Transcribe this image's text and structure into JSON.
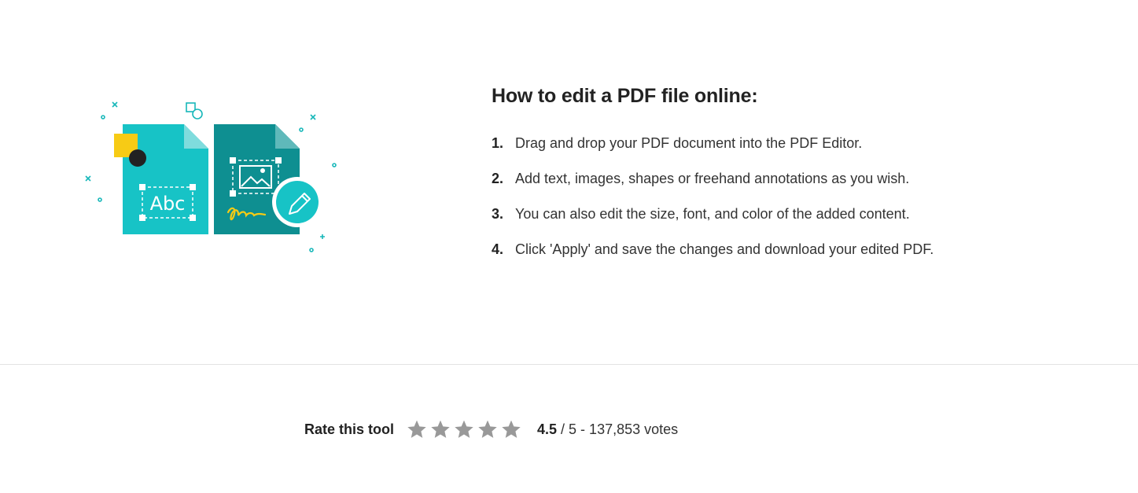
{
  "illustration": {
    "abc_text": "Abc"
  },
  "howto": {
    "title": "How to edit a PDF file online:",
    "steps": [
      {
        "num": "1.",
        "text": "Drag and drop your PDF document into the PDF Editor."
      },
      {
        "num": "2.",
        "text": "Add text, images, shapes or freehand annotations as you wish."
      },
      {
        "num": "3.",
        "text": "You can also edit the size, font, and color of the added content."
      },
      {
        "num": "4.",
        "text": "Click 'Apply' and save the changes and download your edited PDF."
      }
    ]
  },
  "rating": {
    "label": "Rate this tool",
    "score": "4.5",
    "rest": "/ 5 - 137,853 votes",
    "star_count": 5,
    "star_color": "#999999"
  },
  "colors": {
    "teal_light": "#17c3c6",
    "teal_dark": "#0e8f91",
    "yellow": "#f7cb15",
    "dark": "#222222"
  }
}
